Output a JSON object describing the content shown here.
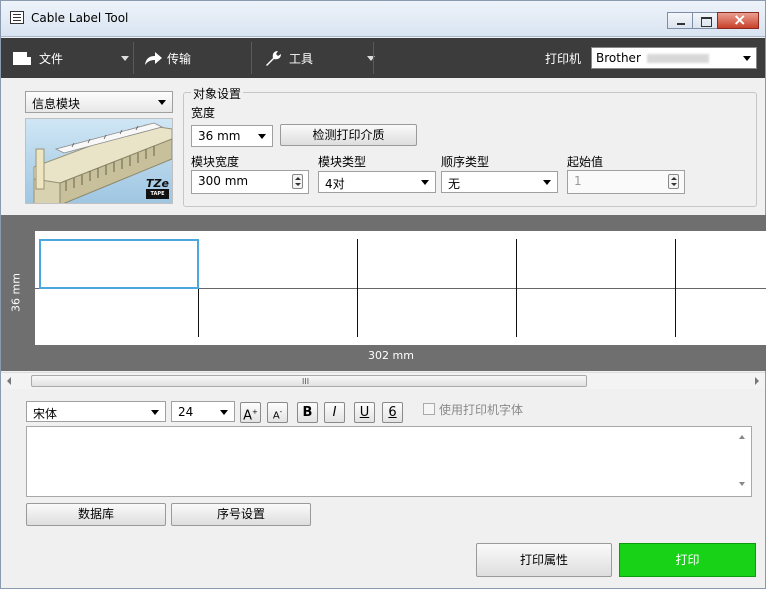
{
  "window": {
    "title": "Cable Label Tool"
  },
  "toolbar": {
    "file_label": "文件",
    "transfer_label": "传输",
    "tools_label": "工具",
    "printer_label": "打印机",
    "printer_value": "Brother"
  },
  "module_select": {
    "value": "信息模块"
  },
  "object_settings": {
    "title": "对象设置",
    "width_label": "宽度",
    "width_value": "36 mm",
    "detect_media_button": "检测打印介质",
    "module_width_label": "模块宽度",
    "module_width_value": "300 mm",
    "module_type_label": "模块类型",
    "module_type_value": "4对",
    "sequence_type_label": "顺序类型",
    "sequence_type_value": "无",
    "start_value_label": "起始值",
    "start_value_value": "1"
  },
  "module_image": {
    "logo_text": "TZe",
    "logo_sub": "TAPE"
  },
  "editor": {
    "width_dimension": "302 mm",
    "height_dimension": "36 mm"
  },
  "format_bar": {
    "font_value": "宋体",
    "size_value": "24",
    "grow_font": "A",
    "shrink_font": "A",
    "bold": "B",
    "italic": "I",
    "underline": "U",
    "frame": "6",
    "use_printer_font_label": "使用打印机字体"
  },
  "bottom": {
    "database_button": "数据库",
    "numbering_button": "序号设置",
    "print_properties_button": "打印属性",
    "print_button": "打印"
  },
  "colors": {
    "toolbar_bg": "#3c3c3c",
    "editor_bg": "#6f6f6f",
    "selection": "#4aa8de",
    "print_button": "#18d218"
  }
}
